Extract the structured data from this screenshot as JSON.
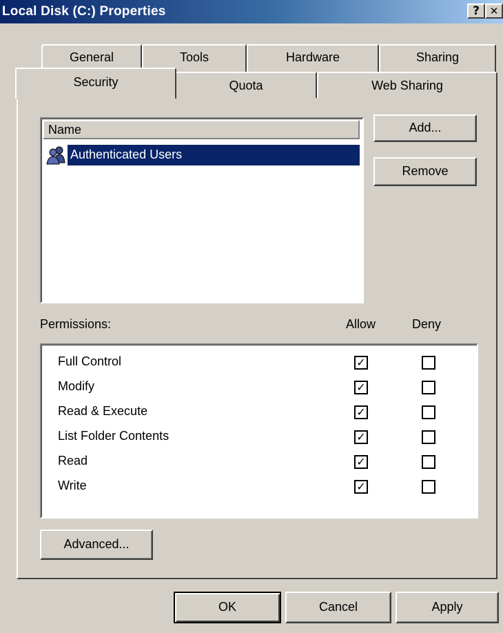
{
  "window": {
    "title": "Local Disk (C:) Properties",
    "help_glyph": "?",
    "close_glyph": "✕"
  },
  "tabs": {
    "row_back": [
      "General",
      "Tools",
      "Hardware",
      "Sharing"
    ],
    "row_front": [
      "Security",
      "Quota",
      "Web Sharing"
    ],
    "active": "Security"
  },
  "security": {
    "list_header": "Name",
    "principals": [
      {
        "name": "Authenticated Users",
        "icon": "user-group-icon",
        "selected": true
      }
    ],
    "add_label": "Add...",
    "remove_label": "Remove",
    "permissions_label": "Permissions:",
    "allow_label": "Allow",
    "deny_label": "Deny",
    "permissions": [
      {
        "name": "Full Control",
        "allow": true,
        "deny": false
      },
      {
        "name": "Modify",
        "allow": true,
        "deny": false
      },
      {
        "name": "Read & Execute",
        "allow": true,
        "deny": false
      },
      {
        "name": "List Folder Contents",
        "allow": true,
        "deny": false
      },
      {
        "name": "Read",
        "allow": true,
        "deny": false
      },
      {
        "name": "Write",
        "allow": true,
        "deny": false
      }
    ],
    "advanced_label": "Advanced..."
  },
  "footer": {
    "ok_label": "OK",
    "cancel_label": "Cancel",
    "apply_label": "Apply"
  },
  "colors": {
    "titlebar_start": "#0a246a",
    "titlebar_end": "#a6caf0",
    "face": "#d4d0c8",
    "selection": "#0a246a"
  }
}
